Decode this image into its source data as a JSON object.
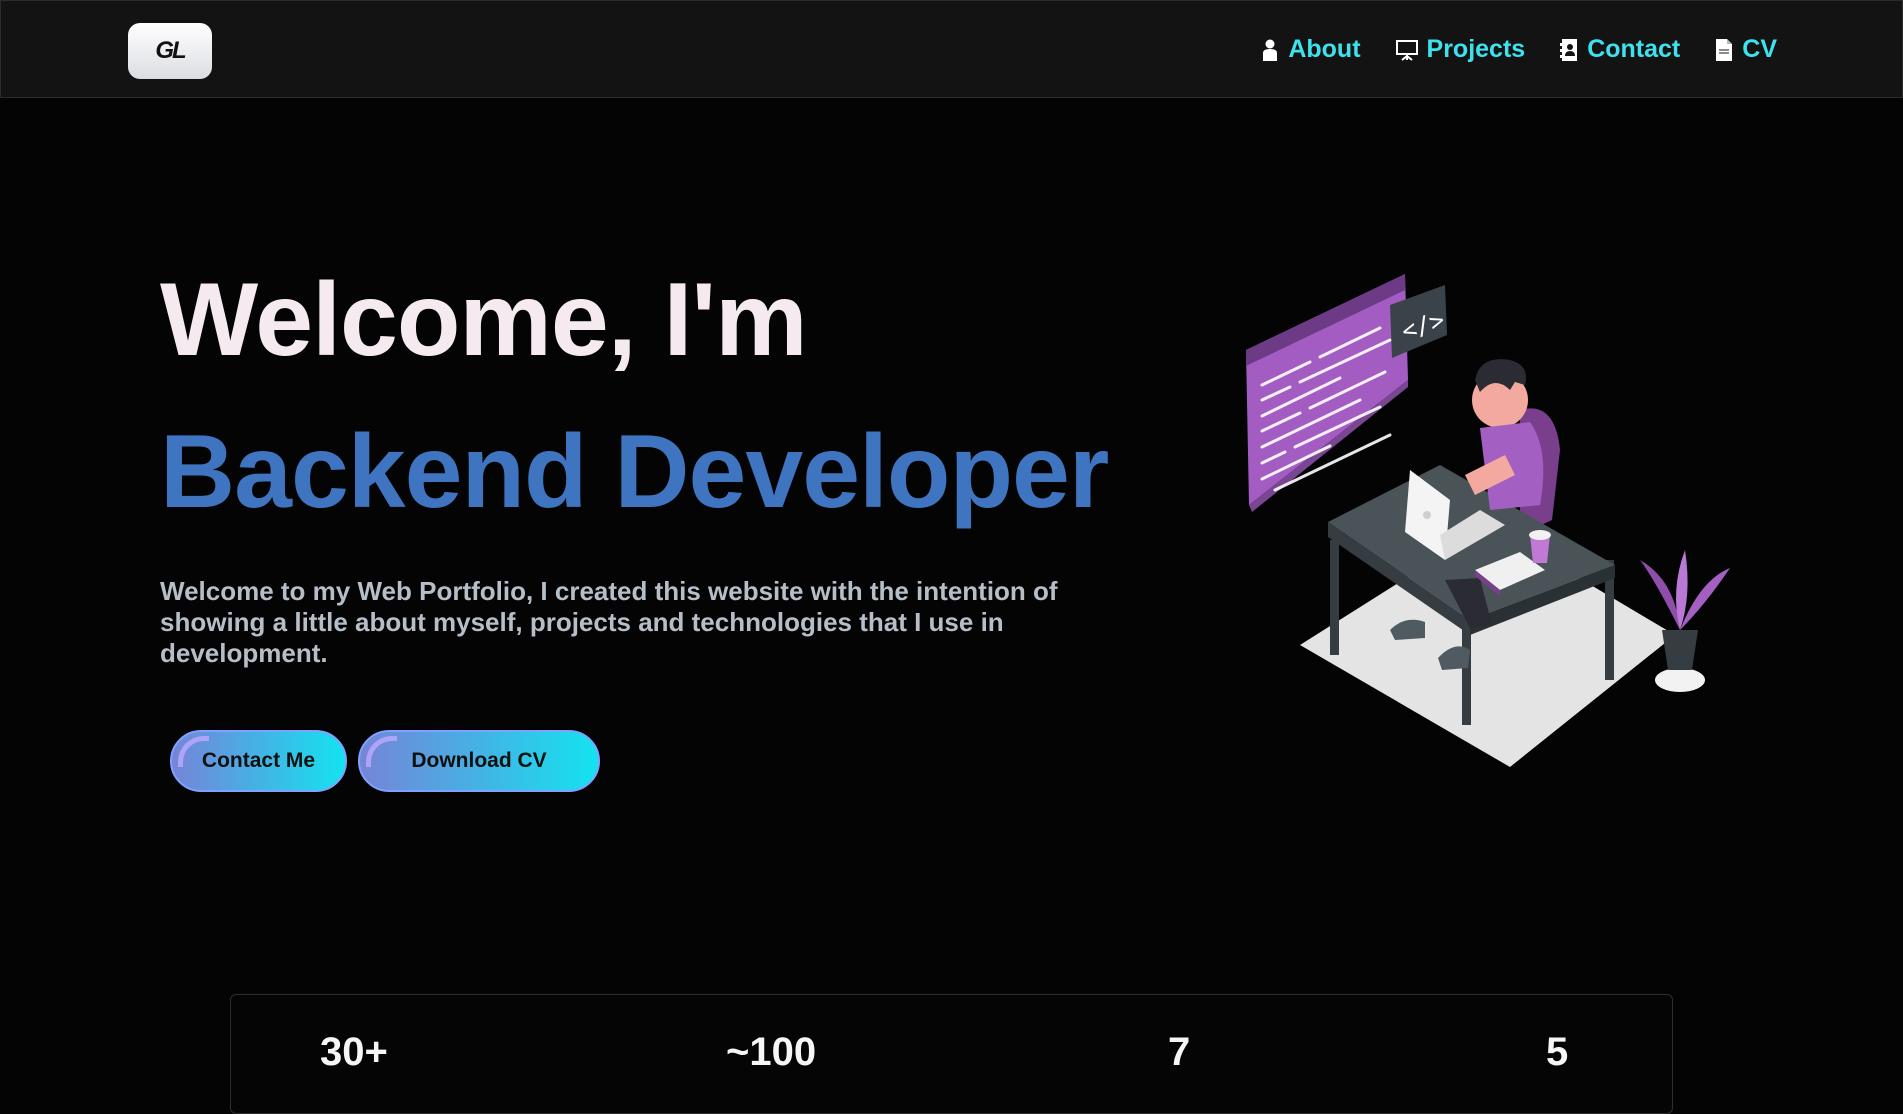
{
  "nav": {
    "logo": "GL",
    "links": [
      {
        "label": "About",
        "icon": "person-icon"
      },
      {
        "label": "Projects",
        "icon": "presentation-icon"
      },
      {
        "label": "Contact",
        "icon": "contact-book-icon"
      },
      {
        "label": "CV",
        "icon": "document-icon"
      }
    ]
  },
  "hero": {
    "greeting": "Welcome, I'm",
    "role": "Backend Developer",
    "description": "Welcome to my Web Portfolio, I created this website with the intention of showing a little about myself, projects and technologies that I use in development.",
    "buttons": {
      "contact": "Contact Me",
      "cv": "Download CV"
    }
  },
  "stats": [
    "30+",
    "~100",
    "7",
    "5"
  ],
  "colors": {
    "nav_link": "#3ee2ee",
    "greeting": "#f5eaef",
    "role": "#3e74c0",
    "description": "#b6bec8",
    "background": "#040405",
    "accent_purple": "#a45fc2"
  }
}
